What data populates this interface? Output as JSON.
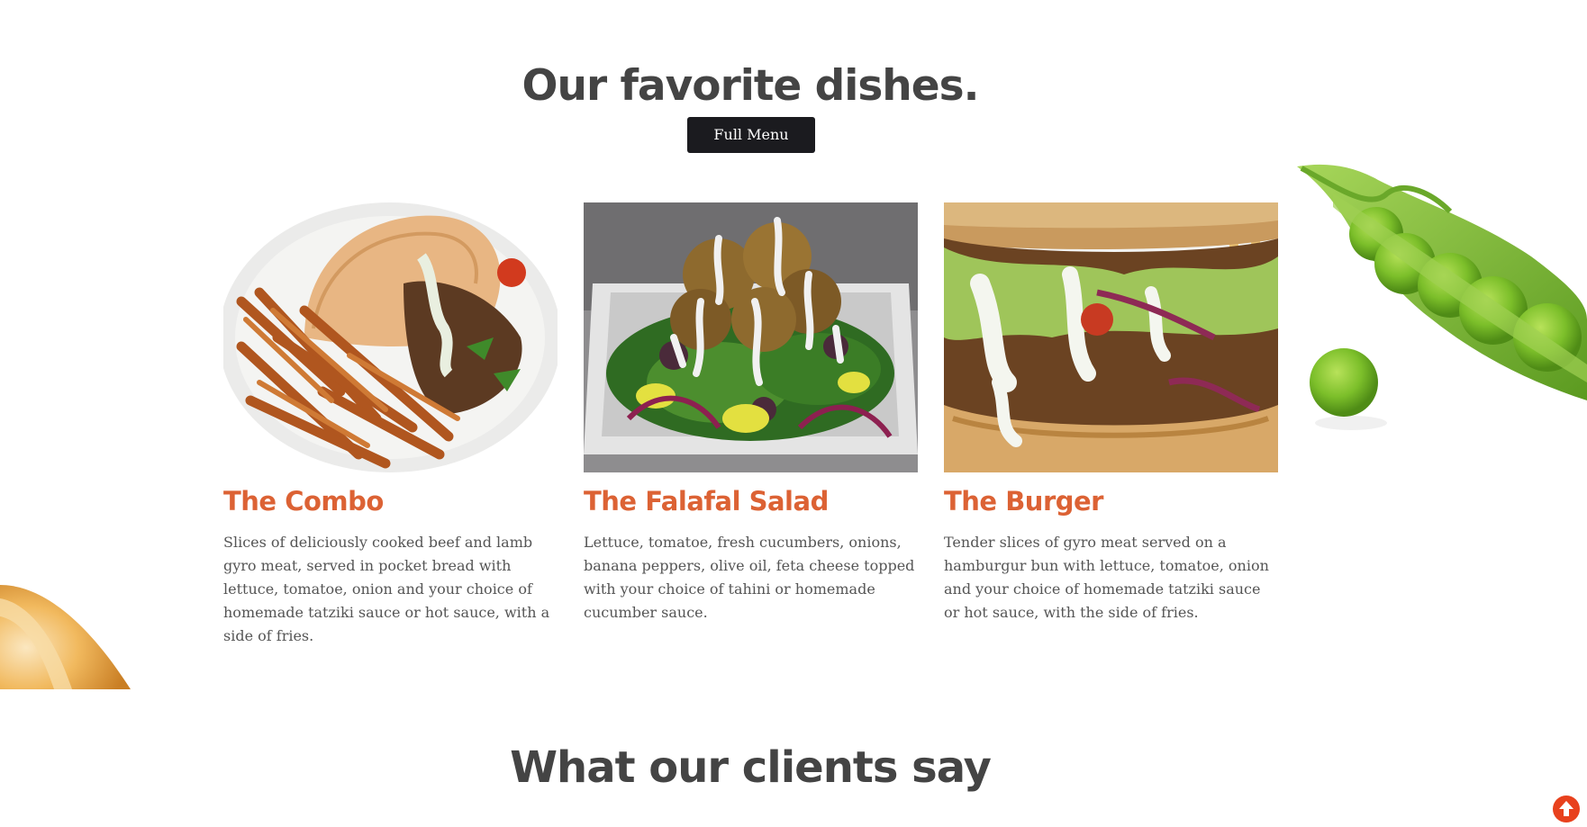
{
  "favorites": {
    "title": "Our favorite dishes.",
    "full_menu_label": "Full Menu"
  },
  "dishes": [
    {
      "name": "The Combo",
      "description": "Slices of deliciously cooked beef and lamb gyro meat, served in pocket bread with lettuce, tomatoe, onion and your choice of homemade tatziki sauce or hot sauce, with a side of fries."
    },
    {
      "name": "The Falafal Salad",
      "description": "Lettuce, tomatoe, fresh cucumbers, onions, banana peppers, olive oil, feta cheese topped with your choice of tahini or homemade cucumber sauce."
    },
    {
      "name": "The Burger",
      "description": "Tender slices of gyro meat served on a hamburgur bun with lettuce, tomatoe, onion and your choice of homemade tatziki sauce or hot sauce, with the side of fries."
    }
  ],
  "clients": {
    "title": "What our clients say"
  },
  "colors": {
    "heading": "#444444",
    "dish_name": "#dc6234",
    "button_bg": "#1b1b1f",
    "scroll_top": "#e8411d"
  },
  "icons": {
    "scroll_top": "arrow-up-icon"
  }
}
